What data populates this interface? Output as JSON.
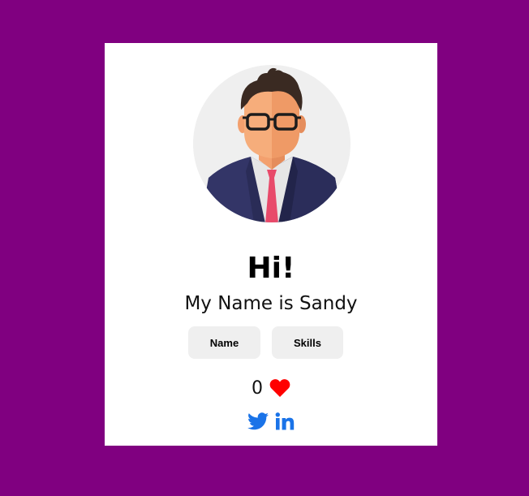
{
  "profile": {
    "greeting": "Hi!",
    "intro": "My Name is Sandy",
    "avatar_icon": "avatar-man-glasses-suit-icon"
  },
  "buttons": {
    "name_label": "Name",
    "skills_label": "Skills"
  },
  "likes": {
    "count": "0",
    "icon": "heart-icon"
  },
  "socials": [
    {
      "icon": "twitter-icon"
    },
    {
      "icon": "linkedin-icon"
    }
  ],
  "colors": {
    "background": "#800080",
    "card": "#ffffff",
    "button_bg": "#efefef",
    "heart": "#ff0000",
    "social": "#1a73e8"
  }
}
